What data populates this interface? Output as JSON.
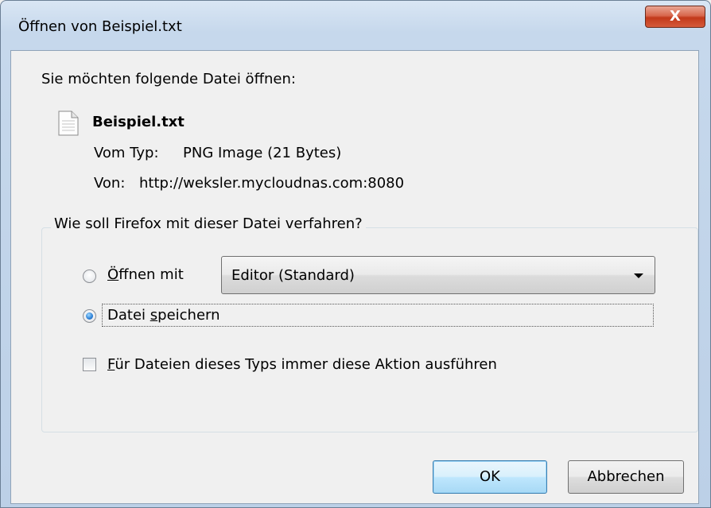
{
  "window": {
    "title": "Öffnen von Beispiel.txt",
    "close_label": "X"
  },
  "dialog": {
    "intro": "Sie möchten folgende Datei öffnen:",
    "file_name": "Beispiel.txt",
    "type_label": "Vom Typ:",
    "type_value": "PNG Image (21 Bytes)",
    "from_label": "Von:",
    "from_value": "http://weksler.mycloudnas.com:8080",
    "group_title": "Wie soll Firefox mit dieser Datei verfahren?",
    "open_with": {
      "label_accel": "Ö",
      "label_rest": "ffnen mit",
      "selected": false,
      "app": "Editor (Standard)"
    },
    "save": {
      "label_pre": "Datei ",
      "label_accel": "s",
      "label_rest": "peichern",
      "selected": true
    },
    "always": {
      "label_accel": "F",
      "label_rest": "ür Dateien dieses Typs immer diese Aktion ausführen",
      "checked": false
    },
    "ok_label": "OK",
    "cancel_label": "Abbrechen"
  },
  "colors": {
    "accent": "#2b7fd6",
    "close_red": "#c2391a"
  },
  "icons": {
    "file": "text-file-icon",
    "close": "close-icon",
    "dropdown": "chevron-down-icon"
  }
}
